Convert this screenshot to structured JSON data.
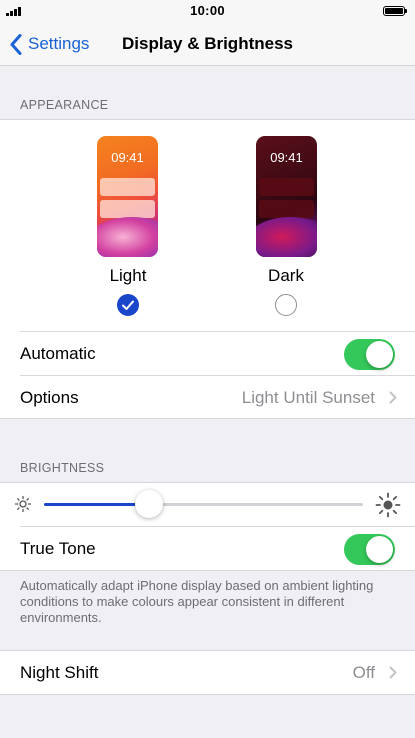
{
  "status_bar": {
    "time": "10:00",
    "signal_icon": "cellular-signal-icon",
    "battery_icon": "battery-full-icon"
  },
  "nav": {
    "back_label": "Settings",
    "back_icon": "chevron-left-icon",
    "title": "Display & Brightness"
  },
  "appearance": {
    "header": "APPEARANCE",
    "light": {
      "preview_time": "09:41",
      "label": "Light",
      "selected": true
    },
    "dark": {
      "preview_time": "09:41",
      "label": "Dark",
      "selected": false
    },
    "automatic": {
      "label": "Automatic",
      "enabled": true
    },
    "options": {
      "label": "Options",
      "value": "Light Until Sunset"
    }
  },
  "brightness": {
    "header": "BRIGHTNESS",
    "level": 0.33,
    "min_icon": "sun-small-icon",
    "max_icon": "sun-large-icon",
    "true_tone": {
      "label": "True Tone",
      "enabled": true
    },
    "footnote": "Automatically adapt iPhone display based on ambient lighting conditions to make colours appear consistent in different environments."
  },
  "night_shift": {
    "label": "Night Shift",
    "value": "Off"
  },
  "colors": {
    "accent": "#1a47c9",
    "link": "#1a62d6",
    "toggle_on": "#34c759",
    "secondary_text": "#8e8e93"
  }
}
